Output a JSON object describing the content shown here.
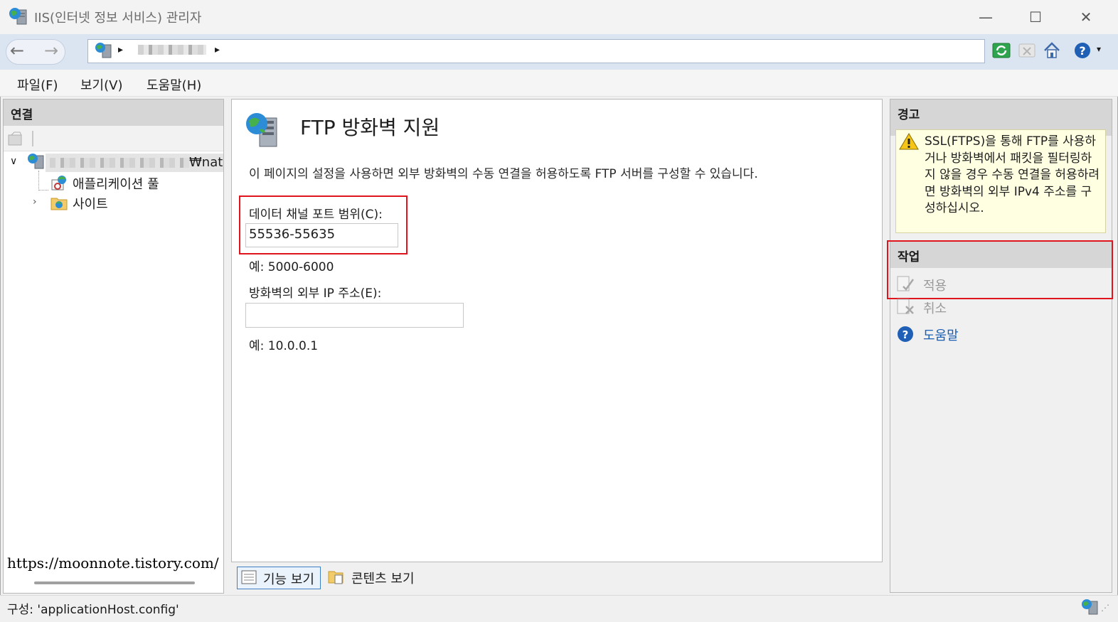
{
  "window": {
    "title": "IIS(인터넷 정보 서비스) 관리자",
    "minimize_glyph": "—",
    "maximize_glyph": "☐",
    "close_glyph": "✕"
  },
  "address": {
    "breadcrumb_separator": "▸"
  },
  "menu": {
    "file": "파일(F)",
    "view": "보기(V)",
    "help": "도움말(H)"
  },
  "connections": {
    "title": "연결",
    "server_suffix": "₩nati",
    "app_pools": "애플리케이션 풀",
    "sites": "사이트"
  },
  "feature": {
    "title": "FTP 방화벽 지원",
    "description": "이 페이지의 설정을 사용하면 외부 방화벽의 수동 연결을 허용하도록 FTP 서버를 구성할 수 있습니다.",
    "port_range_label": "데이터 채널 포트 범위(C):",
    "port_range_value": "55536-55635",
    "port_range_example": "예: 5000-6000",
    "external_ip_label": "방화벽의 외부 IP 주소(E):",
    "external_ip_value": "",
    "external_ip_example": "예: 10.0.0.1"
  },
  "view_tabs": {
    "features_view": "기능 보기",
    "content_view": "콘텐츠 보기"
  },
  "alerts": {
    "title": "경고",
    "message": "SSL(FTPS)을 통해 FTP를 사용하거나 방화벽에서 패킷을 필터링하지 않을 경우 수동 연결을 허용하려면 방화벽의 외부 IPv4 주소를 구성하십시오."
  },
  "actions": {
    "title": "작업",
    "apply": "적용",
    "cancel": "취소",
    "help": "도움말"
  },
  "watermark": "https://moonnote.tistory.com/",
  "status": {
    "config_text": "구성: 'applicationHost.config'"
  },
  "colors": {
    "highlight_border": "#e0141c",
    "link": "#1a5fb4",
    "disabled_text": "#9a9a9a"
  }
}
